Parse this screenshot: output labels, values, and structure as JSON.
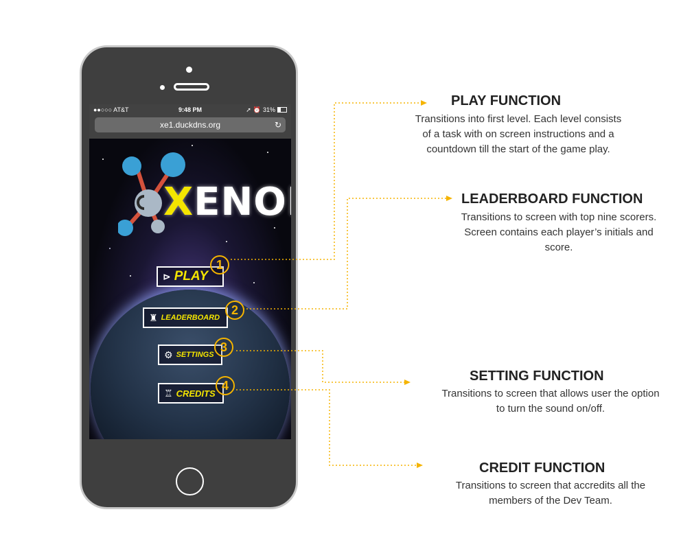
{
  "colors": {
    "accent_yellow": "#f4e500",
    "number_orange": "#f5b400",
    "phone_body": "#3f3f3f",
    "leader_line": "#f5b400"
  },
  "status_bar": {
    "carrier": "●●○○○ AT&T",
    "time": "9:48 PM",
    "battery": "31%"
  },
  "browser": {
    "url": "xe1.duckdns.org",
    "reload_icon": "↻"
  },
  "game": {
    "logo_text_x": "X",
    "logo_text_rest": "ENON",
    "buttons": [
      {
        "label": "PLAY",
        "icon": "play-circle-icon",
        "number": "1"
      },
      {
        "label": "LEADERBOARD",
        "icon": "trophy-icon",
        "number": "2"
      },
      {
        "label": "SETTINGS",
        "icon": "gear-icon",
        "number": "3"
      },
      {
        "label": "CREDITS",
        "icon": "robot-icon",
        "number": "4"
      }
    ]
  },
  "safari_toolbar": {
    "back": "‹",
    "forward": "›",
    "share": "⇪",
    "bookmarks": "📖",
    "tabs": "❐"
  },
  "annotations": [
    {
      "title": "PLAY FUNCTION",
      "lines": [
        "Transitions into first level. Each level consists",
        "of a task with on screen instructions and a",
        "countdown till the start of the game play."
      ]
    },
    {
      "title": "LEADERBOARD FUNCTION",
      "lines": [
        "Transitions to screen with top nine scorers.",
        "Screen contains each player’s initials and",
        "score."
      ]
    },
    {
      "title": "SETTING FUNCTION",
      "lines": [
        "Transitions to screen that allows user the option",
        "to turn the sound on/off."
      ]
    },
    {
      "title": "CREDIT FUNCTION",
      "lines": [
        "Transitions to screen that accredits all the",
        "members of the Dev Team."
      ]
    }
  ]
}
